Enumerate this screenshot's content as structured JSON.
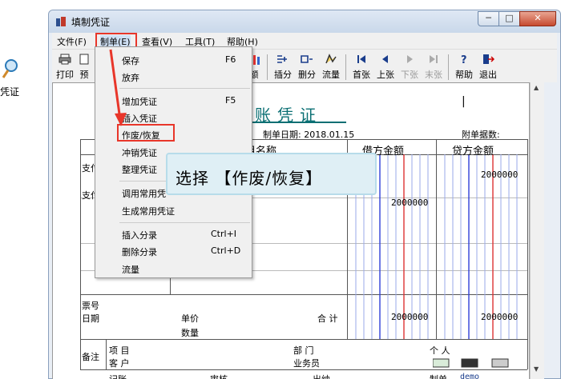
{
  "desktop": {
    "icon_label": "凭证"
  },
  "window": {
    "title": "填制凭证",
    "min": "─",
    "max": "□",
    "close": "✕"
  },
  "menubar": [
    "文件(F)",
    "制单(E)",
    "查看(V)",
    "工具(T)",
    "帮助(H)"
  ],
  "toolbar": {
    "left": [
      "打印",
      "预"
    ],
    "left_partial": "额",
    "right": [
      "插分",
      "删分",
      "流量",
      "首张",
      "上张",
      "下张",
      "末张",
      "帮助",
      "退出"
    ],
    "disabled": [
      "下张",
      "末张"
    ]
  },
  "voucher": {
    "title": "账凭证",
    "date_label": "制单日期:",
    "date_value": "2018.01.15",
    "attach_label": "附单据数:",
    "col_account": "目名称",
    "col_debit": "借方金额",
    "col_credit": "贷方金额",
    "row1_prefix": "支付",
    "row2_prefix": "支付",
    "row1_credit": "2000000",
    "row2_debit": "2000000",
    "ticket_no": "票号",
    "date_row": "日期",
    "unit_price": "单价",
    "quantity": "数量",
    "total_label": "合 计",
    "total_debit": "2000000",
    "total_credit": "2000000",
    "note": "备注",
    "project": "项  目",
    "customer": "客  户",
    "dept": "部  门",
    "person": "个  人",
    "salesman": "业务员",
    "footer": [
      "记账",
      "审核",
      "出纳",
      "制单"
    ],
    "maker": "demo"
  },
  "dropdown": {
    "items": [
      {
        "label": "保存",
        "shortcut": "F6"
      },
      {
        "label": "放弃",
        "shortcut": ""
      },
      {
        "label": "增加凭证",
        "shortcut": "F5"
      },
      {
        "label": "插入凭证",
        "shortcut": ""
      },
      {
        "label": "作废/恢复",
        "shortcut": ""
      },
      {
        "label": "冲销凭证",
        "shortcut": ""
      },
      {
        "label": "整理凭证",
        "shortcut": ""
      },
      {
        "label": "调用常用凭",
        "shortcut": ""
      },
      {
        "label": "生成常用凭证",
        "shortcut": ""
      },
      {
        "label": "插入分录",
        "shortcut": "Ctrl+I"
      },
      {
        "label": "删除分录",
        "shortcut": "Ctrl+D"
      },
      {
        "label": "流量",
        "shortcut": ""
      }
    ]
  },
  "callout": {
    "text": "选择 【作废/恢复】"
  },
  "colors": {
    "accent_red": "#e8362a",
    "voucher_teal": "#0a6f73",
    "debit_blue": "#2f3fd8",
    "credit_red": "#d33"
  }
}
